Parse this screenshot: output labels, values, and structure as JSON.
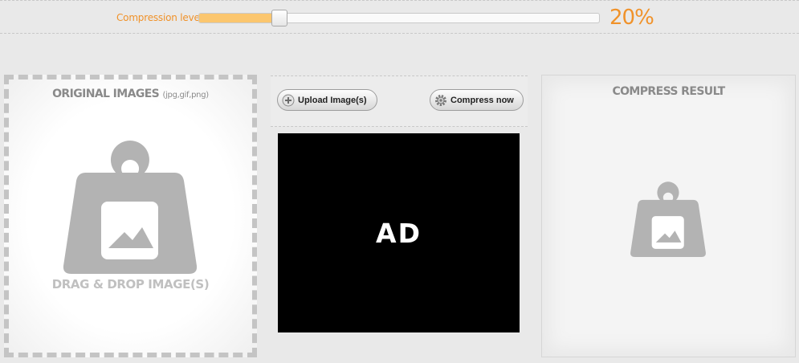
{
  "compression": {
    "label": "Compression level",
    "value_text": "20%",
    "level": 0.2,
    "accent_color": "#f0922a",
    "fill_color": "#fbc66e"
  },
  "original_panel": {
    "title": "ORIGINAL IMAGES",
    "formats": "(jpg,gif,png)",
    "drop_text": "DRAG & DROP IMAGE(S)",
    "icon": "weight-image-icon"
  },
  "toolbar": {
    "upload_label": "Upload Image(s)",
    "upload_icon": "plus-circle-icon",
    "compress_label": "Compress now",
    "compress_icon": "gear-icon"
  },
  "ad": {
    "text": "AD"
  },
  "result_panel": {
    "title": "COMPRESS RESULT",
    "icon": "weight-image-icon"
  }
}
